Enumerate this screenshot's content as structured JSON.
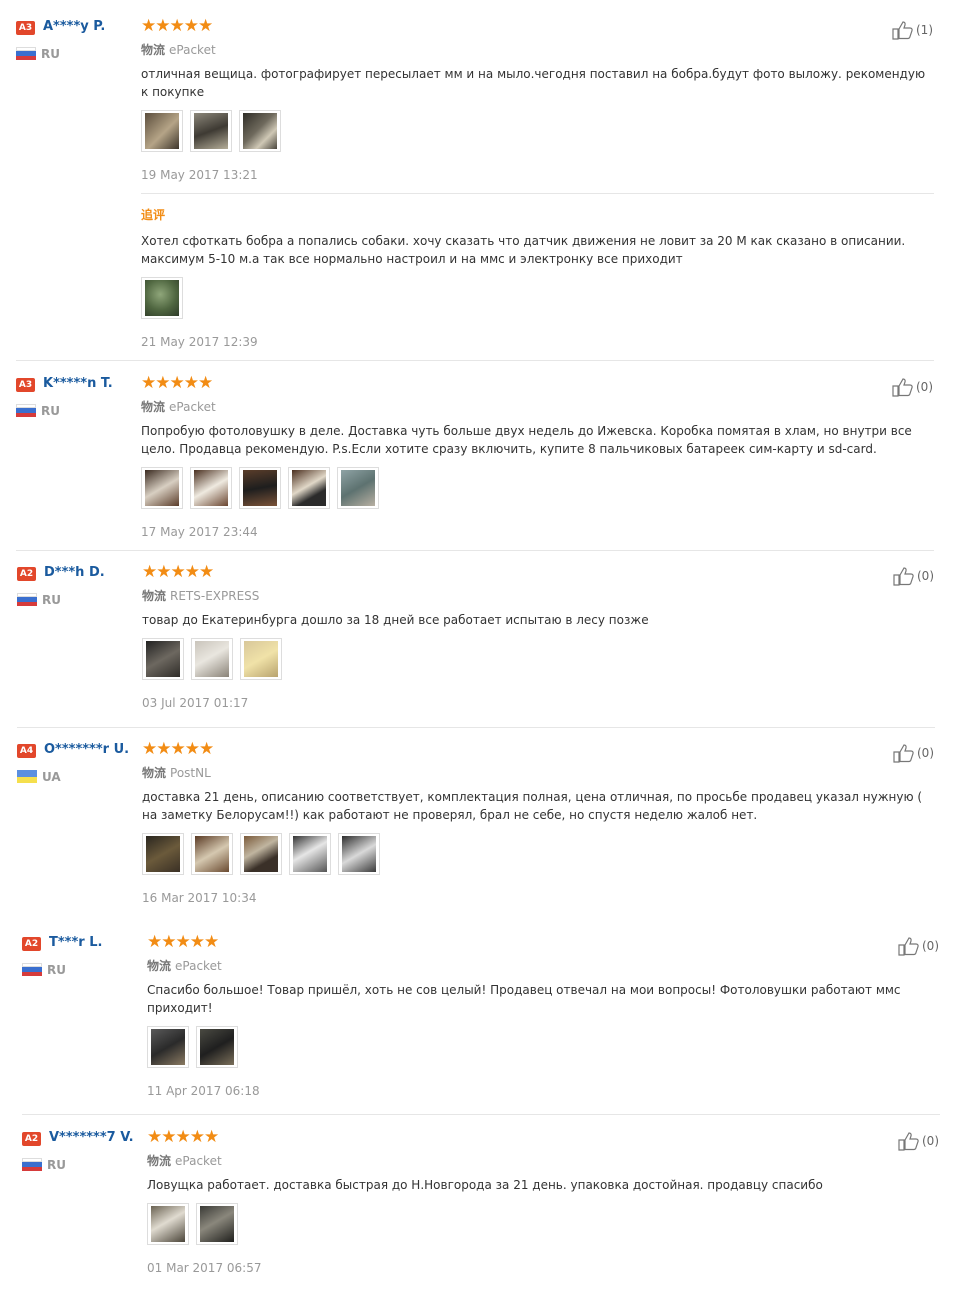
{
  "reviews": [
    {
      "level": "A3",
      "name": "A****y P.",
      "country": "RU",
      "stars": "★★★★★",
      "logistics_label": "物流",
      "logistics": "ePacket",
      "text": "отличная вещица. фотографирует пересылает мм и на мыло.чегодня поставил на бобра.будут фото выложу. рекомендую к покупке",
      "photos": [
        "photo-1",
        "photo-2",
        "photo-3"
      ],
      "date": "19 May 2017 13:21",
      "likes": "(1)",
      "additional": {
        "label": "追评",
        "text": "Хотел сфоткать бобра а попались собаки. хочу сказать что датчик движения не ловит за 20 М как сказано в описании. максимум 5-10 м.а так все нормально настроил и на ммс и электронку все приходит",
        "date": "21 May 2017 12:39"
      }
    },
    {
      "level": "A3",
      "name": "K*****n T.",
      "country": "RU",
      "stars": "★★★★★",
      "logistics_label": "物流",
      "logistics": "ePacket",
      "text": "Попробую фотоловушку в деле. Доставка чуть больше двух недель до Ижевска. Коробка помятая в хлам, но внутри все цело. Продавца рекомендую. P.s.Если хотите сразу включить, купите 8 пальчиковых батареек сим-карту и sd-card.",
      "date": "17 May 2017 23:44",
      "likes": "(0)"
    },
    {
      "level": "A2",
      "name": "D***h D.",
      "country": "RU",
      "stars": "★★★★★",
      "logistics_label": "物流",
      "logistics": "RETS-EXPRESS",
      "text": "товар до Екатеринбурга дошло за 18 дней все работает испытаю в лесу позже",
      "date": "03 Jul 2017 01:17",
      "likes": "(0)"
    },
    {
      "level": "A4",
      "name": "O*******r U.",
      "country": "UA",
      "stars": "★★★★★",
      "logistics_label": "物流",
      "logistics": "PostNL",
      "text": "доставка 21 день, описанию соответствует, комплектация полная, цена отличная, по просьбе продавец указал нужную ( на заметку Белорусам!!) как работают не проверял, брал не себе, но спустя неделю жалоб нет.",
      "date": "16 Mar 2017 10:34",
      "likes": "(0)"
    },
    {
      "level": "A2",
      "name": "T***r L.",
      "country": "RU",
      "stars": "★★★★★",
      "logistics_label": "物流",
      "logistics": "ePacket",
      "text": "Спасибо большое! Товар пришёл, хоть не сов целый! Продавец отвечал на мои вопросы! Фотоловушки работают ммс приходит!",
      "date": "11 Apr 2017 06:18",
      "likes": "(0)"
    },
    {
      "level": "A2",
      "name": "V*******7 V.",
      "country": "RU",
      "stars": "★★★★★",
      "logistics_label": "物流",
      "logistics": "ePacket",
      "text": "Ловущка работает. доставка быстрая до Н.Новгорода за 21 день. упаковка достойная. продавцу спасибо",
      "date": "01 Mar 2017 06:57",
      "likes": "(0)"
    }
  ],
  "colors": {
    "name": "#1a5a9e",
    "stars": "#f28c14",
    "badge": "#e2472b",
    "muted": "#999999"
  }
}
